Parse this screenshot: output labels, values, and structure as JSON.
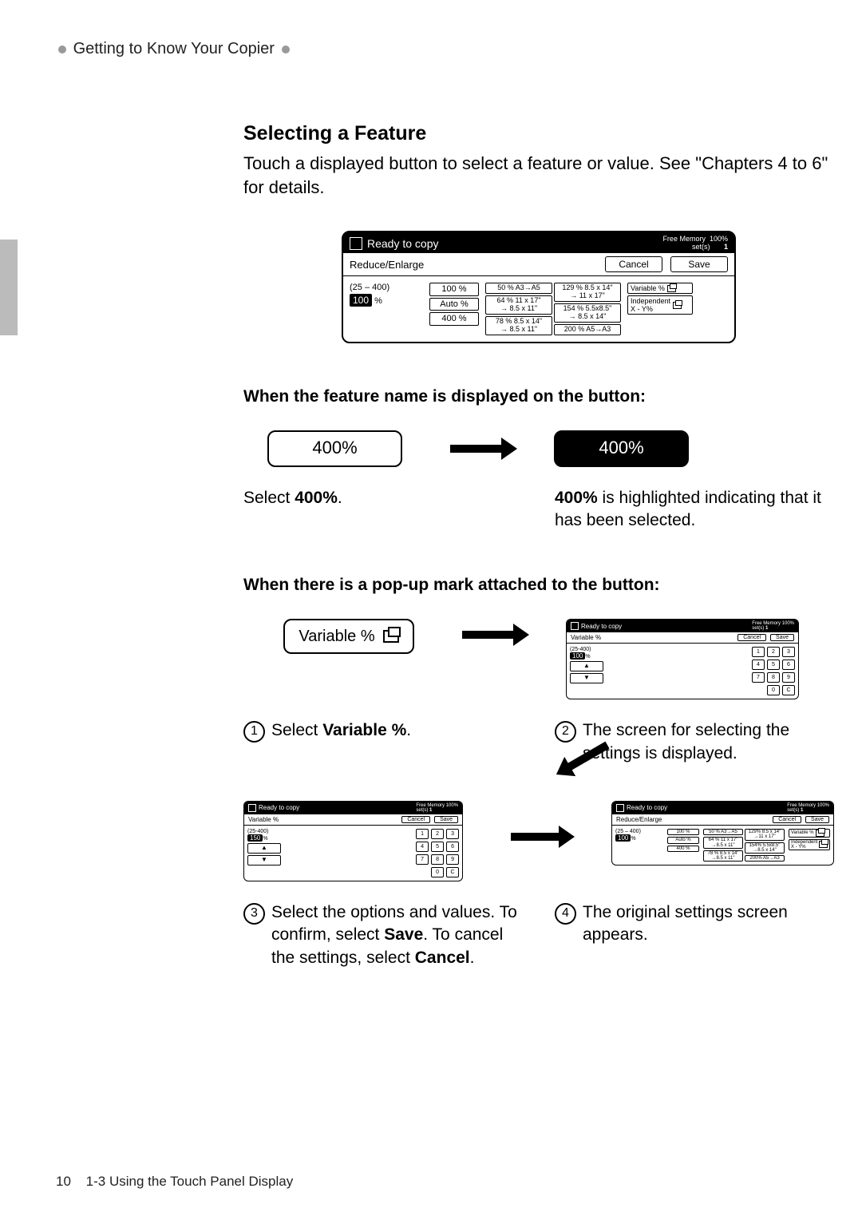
{
  "running_head": "Getting to Know Your Copier",
  "section_title": "Selecting a Feature",
  "intro": "Touch a displayed button to select a feature or value. See \"Chapters 4 to 6\" for details.",
  "screen": {
    "status": "Ready to copy",
    "mem_label": "Free Memory",
    "mem_val": "100%",
    "sets_label": "set(s)",
    "sets_val": "1",
    "tab": "Reduce/Enlarge",
    "cancel": "Cancel",
    "save": "Save",
    "range": "(25 – 400)",
    "value": "100",
    "pct": "%",
    "presets": {
      "p100": "100 %",
      "auto": "Auto %",
      "p400": "400 %"
    },
    "col1": {
      "a": "50 %   A3→A5",
      "b": "64 %   11 x 17\"\n→ 8.5 x 11\"",
      "c": "78 %   8.5 x 14\"\n→ 8.5 x 11\""
    },
    "col2": {
      "a": "129 % 8.5 x 14\"\n→ 11 x 17\"",
      "b": "154 % 5.5x8.5\"\n→ 8.5 x 14\"",
      "c": "200 % A5→A3"
    },
    "rcol": {
      "var": "Variable %",
      "ind": "Independent\nX - Y%"
    }
  },
  "case1": {
    "heading": "When the feature name is displayed on the button:",
    "btn": "400%",
    "left_pre": "Select ",
    "left_b": "400%",
    "left_post": ".",
    "right_b": "400%",
    "right_post": " is highlighted indicating that it has been selected."
  },
  "case2": {
    "heading": "When there is a pop-up mark attached to the button:",
    "varbtn": "Variable %",
    "step1_pre": "Select ",
    "step1_b": "Variable %",
    "step1_post": ".",
    "step2": "The screen for selecting the settings is displayed.",
    "step3_a": "Select the options and values.  To confirm, select ",
    "step3_b": "Save",
    "step3_c": ".  To cancel the settings, select ",
    "step3_d": "Cancel",
    "step3_e": ".",
    "step4": "The original settings screen appears."
  },
  "mini": {
    "status": "Ready to copy",
    "tab_var": "Variable %",
    "tab_re": "Reduce/Enlarge",
    "cancel": "Cancel",
    "save": "Save",
    "range": "(25-400)",
    "val100": "100",
    "val150": "150",
    "pct": "%",
    "keys": [
      "1",
      "2",
      "3",
      "4",
      "5",
      "6",
      "7",
      "8",
      "9",
      "",
      "0",
      "C"
    ],
    "up": "▲",
    "down": "▼",
    "c1": {
      "a": "50 %  A3→A5",
      "b": "64 %  11 x 17\"\n→8.5 x 11\"",
      "c": "78 %  8.5 x 14\"\n→8.5 x 11\""
    },
    "c2": {
      "a": "129% 8.5 x 14\"\n→11 x 17\"",
      "b": "154% 5.5x8.5\"\n→8.5 x 14\"",
      "c": "200% A5→A3"
    },
    "var": "Variable %",
    "ind": "Independent\nX - Y%",
    "p100": "100 %",
    "auto": "Auto %",
    "p400": "400 %"
  },
  "footer": {
    "page": "10",
    "text": "1-3  Using the Touch Panel Display"
  }
}
